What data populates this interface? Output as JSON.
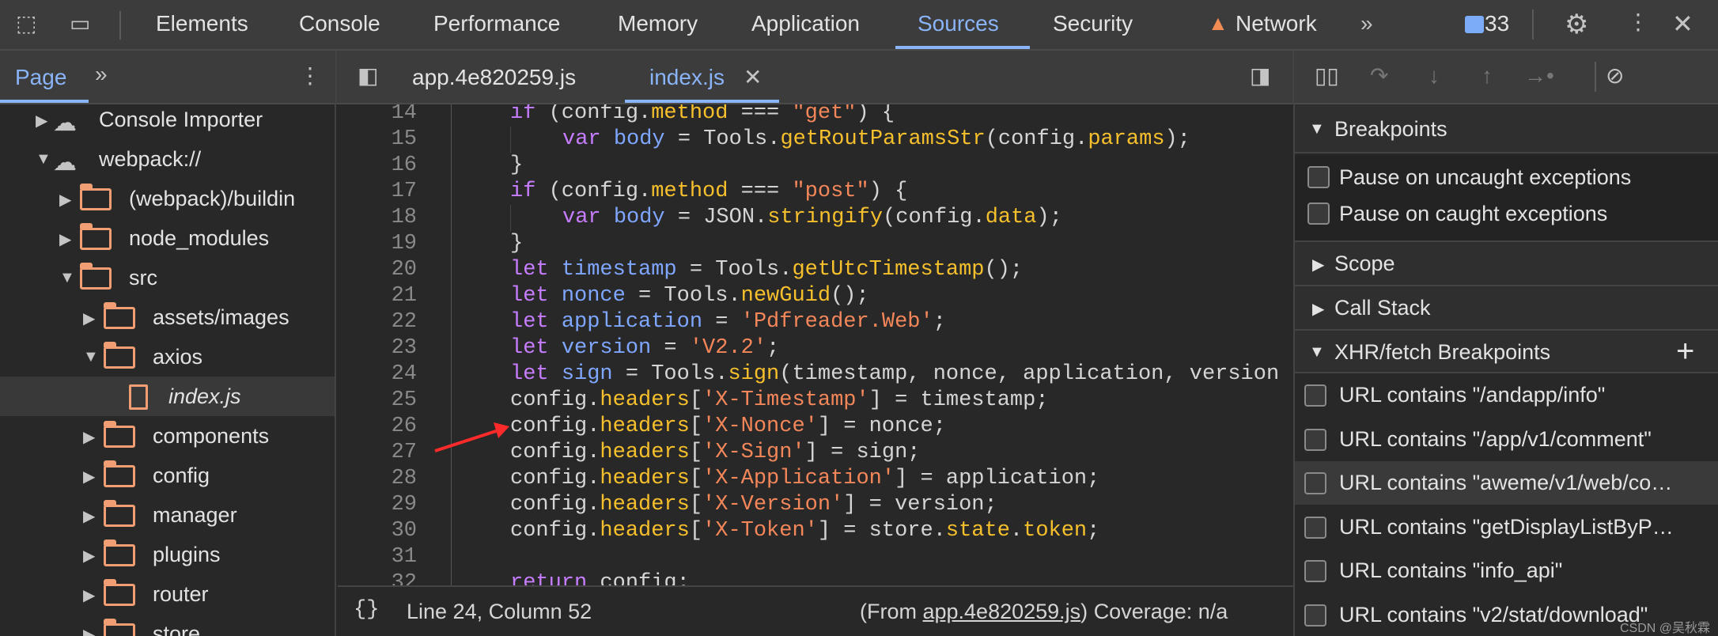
{
  "topbar": {
    "tabs": [
      "Elements",
      "Console",
      "Performance",
      "Memory",
      "Application",
      "Sources",
      "Security",
      "Network"
    ],
    "active": "Sources",
    "issues_count": "33",
    "accent": "#8ab4f8"
  },
  "navigator": {
    "tab": "Page",
    "tree": [
      {
        "label": "Console Importer",
        "type": "cloud",
        "level": 0,
        "expanded": false
      },
      {
        "label": "webpack://",
        "type": "cloud",
        "level": 0,
        "expanded": true
      },
      {
        "label": "(webpack)/buildin",
        "type": "folder",
        "level": 1,
        "expanded": false
      },
      {
        "label": "node_modules",
        "type": "folder",
        "level": 1,
        "expanded": false
      },
      {
        "label": "src",
        "type": "folder",
        "level": 1,
        "expanded": true
      },
      {
        "label": "assets/images",
        "type": "folder",
        "level": 2,
        "expanded": false
      },
      {
        "label": "axios",
        "type": "folder",
        "level": 2,
        "expanded": true
      },
      {
        "label": "index.js",
        "type": "file",
        "level": 3,
        "selected": true
      },
      {
        "label": "components",
        "type": "folder",
        "level": 2,
        "expanded": false
      },
      {
        "label": "config",
        "type": "folder",
        "level": 2,
        "expanded": false
      },
      {
        "label": "manager",
        "type": "folder",
        "level": 2,
        "expanded": false
      },
      {
        "label": "plugins",
        "type": "folder",
        "level": 2,
        "expanded": false
      },
      {
        "label": "router",
        "type": "folder",
        "level": 2,
        "expanded": false
      },
      {
        "label": "store",
        "type": "folder",
        "level": 2,
        "expanded": false
      }
    ]
  },
  "editor": {
    "tabs": [
      "app.4e820259.js",
      "index.js"
    ],
    "active_tab": "index.js",
    "lines": [
      {
        "n": "14",
        "t": [
          [
            "if",
            "k"
          ],
          [
            " (config.",
            "p"
          ],
          [
            "method",
            "f"
          ],
          [
            " === ",
            "p"
          ],
          [
            "\"get\"",
            "s"
          ],
          [
            ") {",
            "p"
          ]
        ],
        "i": 0
      },
      {
        "n": "15",
        "t": [
          [
            "var",
            "k"
          ],
          [
            " ",
            "p"
          ],
          [
            "body",
            "v"
          ],
          [
            " = Tools.",
            "p"
          ],
          [
            "getRoutParamsStr",
            "f"
          ],
          [
            "(config.",
            "p"
          ],
          [
            "params",
            "f"
          ],
          [
            ");",
            "p"
          ]
        ],
        "i": 1
      },
      {
        "n": "16",
        "t": [
          [
            "}",
            "p"
          ]
        ],
        "i": 0
      },
      {
        "n": "17",
        "t": [
          [
            "if",
            "k"
          ],
          [
            " (config.",
            "p"
          ],
          [
            "method",
            "f"
          ],
          [
            " === ",
            "p"
          ],
          [
            "\"post\"",
            "s"
          ],
          [
            ") {",
            "p"
          ]
        ],
        "i": 0
      },
      {
        "n": "18",
        "t": [
          [
            "var",
            "k"
          ],
          [
            " ",
            "p"
          ],
          [
            "body",
            "v"
          ],
          [
            " = JSON.",
            "p"
          ],
          [
            "stringify",
            "f"
          ],
          [
            "(config.",
            "p"
          ],
          [
            "data",
            "f"
          ],
          [
            ");",
            "p"
          ]
        ],
        "i": 1
      },
      {
        "n": "19",
        "t": [
          [
            "}",
            "p"
          ]
        ],
        "i": 0
      },
      {
        "n": "20",
        "t": [
          [
            "let",
            "k"
          ],
          [
            " ",
            "p"
          ],
          [
            "timestamp",
            "v"
          ],
          [
            " = Tools.",
            "p"
          ],
          [
            "getUtcTimestamp",
            "f"
          ],
          [
            "();",
            "p"
          ]
        ],
        "i": 0
      },
      {
        "n": "21",
        "t": [
          [
            "let",
            "k"
          ],
          [
            " ",
            "p"
          ],
          [
            "nonce",
            "v"
          ],
          [
            " = Tools.",
            "p"
          ],
          [
            "newGuid",
            "f"
          ],
          [
            "();",
            "p"
          ]
        ],
        "i": 0
      },
      {
        "n": "22",
        "t": [
          [
            "let",
            "k"
          ],
          [
            " ",
            "p"
          ],
          [
            "application",
            "v"
          ],
          [
            " = ",
            "p"
          ],
          [
            "'Pdfreader.Web'",
            "s"
          ],
          [
            ";",
            "p"
          ]
        ],
        "i": 0
      },
      {
        "n": "23",
        "t": [
          [
            "let",
            "k"
          ],
          [
            " ",
            "p"
          ],
          [
            "version",
            "v"
          ],
          [
            " = ",
            "p"
          ],
          [
            "'V2.2'",
            "s"
          ],
          [
            ";",
            "p"
          ]
        ],
        "i": 0
      },
      {
        "n": "24",
        "t": [
          [
            "let",
            "k"
          ],
          [
            " ",
            "p"
          ],
          [
            "sign",
            "v"
          ],
          [
            " = Tools.",
            "p"
          ],
          [
            "sign",
            "f"
          ],
          [
            "(timestamp, nonce, application, version",
            "p"
          ]
        ],
        "i": 0
      },
      {
        "n": "25",
        "t": [
          [
            "config.",
            "p"
          ],
          [
            "headers",
            "f"
          ],
          [
            "[",
            "p"
          ],
          [
            "'X-Timestamp'",
            "s"
          ],
          [
            "] = timestamp;",
            "p"
          ]
        ],
        "i": 0
      },
      {
        "n": "26",
        "t": [
          [
            "config.",
            "p"
          ],
          [
            "headers",
            "f"
          ],
          [
            "[",
            "p"
          ],
          [
            "'X-Nonce'",
            "s"
          ],
          [
            "] = nonce;",
            "p"
          ]
        ],
        "i": 0
      },
      {
        "n": "27",
        "t": [
          [
            "config.",
            "p"
          ],
          [
            "headers",
            "f"
          ],
          [
            "[",
            "p"
          ],
          [
            "'X-Sign'",
            "s"
          ],
          [
            "] = sign;",
            "p"
          ]
        ],
        "i": 0
      },
      {
        "n": "28",
        "t": [
          [
            "config.",
            "p"
          ],
          [
            "headers",
            "f"
          ],
          [
            "[",
            "p"
          ],
          [
            "'X-Application'",
            "s"
          ],
          [
            "] = application;",
            "p"
          ]
        ],
        "i": 0
      },
      {
        "n": "29",
        "t": [
          [
            "config.",
            "p"
          ],
          [
            "headers",
            "f"
          ],
          [
            "[",
            "p"
          ],
          [
            "'X-Version'",
            "s"
          ],
          [
            "] = version;",
            "p"
          ]
        ],
        "i": 0
      },
      {
        "n": "30",
        "t": [
          [
            "config.",
            "p"
          ],
          [
            "headers",
            "f"
          ],
          [
            "[",
            "p"
          ],
          [
            "'X-Token'",
            "s"
          ],
          [
            "] = store.",
            "p"
          ],
          [
            "state",
            "f"
          ],
          [
            ".",
            "p"
          ],
          [
            "token",
            "f"
          ],
          [
            ";",
            "p"
          ]
        ],
        "i": 0
      },
      {
        "n": "31",
        "t": [],
        "i": 0
      },
      {
        "n": "32",
        "t": [
          [
            "return",
            "k"
          ],
          [
            " config;",
            "p"
          ]
        ],
        "i": 0
      }
    ]
  },
  "status": {
    "position": "Line 24, Column 52",
    "from_prefix": "(From ",
    "from_link": "app.4e820259.js",
    "from_suffix": ")",
    "coverage": "Coverage: n/a"
  },
  "debugger": {
    "breakpoints_title": "Breakpoints",
    "pause_uncaught": "Pause on uncaught exceptions",
    "pause_caught": "Pause on caught exceptions",
    "scope": "Scope",
    "call_stack": "Call Stack",
    "xhr_title": "XHR/fetch Breakpoints",
    "xhr_items": [
      "URL contains \"/andapp/info\"",
      "URL contains \"/app/v1/comment\"",
      "URL contains \"aweme/v1/web/co…",
      "URL contains \"getDisplayListByP…",
      "URL contains \"info_api\"",
      "URL contains \"v2/stat/download\""
    ]
  },
  "watermark": "CSDN @吴秋霖"
}
